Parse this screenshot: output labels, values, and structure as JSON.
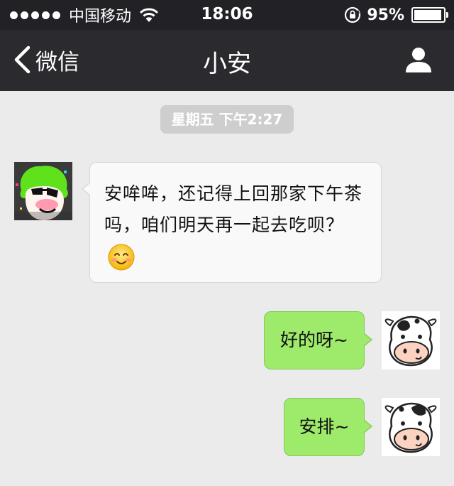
{
  "status_bar": {
    "carrier": "中国移动",
    "time": "18:06",
    "battery_percent": "95%",
    "battery_level": 0.95,
    "signal_bars": 5
  },
  "nav": {
    "back_label": "微信",
    "title": "小安",
    "right_icon": "profile-icon"
  },
  "conversation": {
    "timestamp": "星期五 下午2:27",
    "messages": [
      {
        "sender": "contact",
        "text": "安哞哞，还记得上回那家下午茶吗，咱们明天再一起去吃呗？",
        "emoji": "smiling-blush-emoji"
      },
      {
        "sender": "me",
        "text": "好的呀~"
      },
      {
        "sender": "me",
        "text": "安排~"
      }
    ]
  },
  "colors": {
    "nav_bg": "#2b2b2f",
    "chat_bg": "#ebebeb",
    "incoming_bubble": "#f9f9f9",
    "outgoing_bubble": "#9eea6a",
    "timestamp_bg": "#cecece"
  }
}
